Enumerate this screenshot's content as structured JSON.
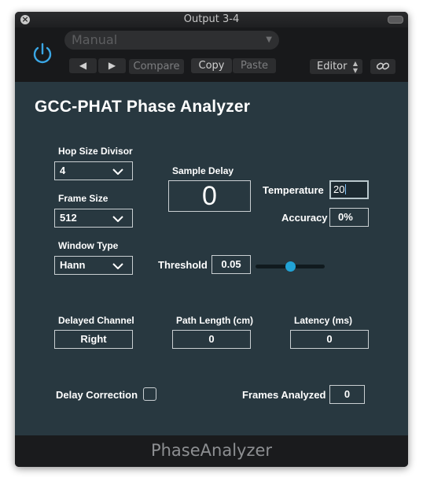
{
  "window": {
    "title": "Output 3-4"
  },
  "header": {
    "preset_value": "Manual",
    "prev_label": "◀",
    "next_label": "▶",
    "compare_label": "Compare",
    "copy_label": "Copy",
    "paste_label": "Paste",
    "editor_label": "Editor"
  },
  "plugin": {
    "title": "GCC-PHAT Phase Analyzer",
    "hop_size": {
      "label": "Hop Size Divisor",
      "value": "4"
    },
    "frame_size": {
      "label": "Frame Size",
      "value": "512"
    },
    "window_type": {
      "label": "Window Type",
      "value": "Hann"
    },
    "sample_delay": {
      "label": "Sample Delay",
      "value": "0"
    },
    "temperature": {
      "label": "Temperature",
      "value": "20"
    },
    "accuracy": {
      "label": "Accuracy",
      "value": "0%"
    },
    "threshold": {
      "label": "Threshold",
      "value": "0.05",
      "slider_fraction": 0.5
    },
    "delayed_channel": {
      "label": "Delayed Channel",
      "value": "Right"
    },
    "path_length": {
      "label": "Path Length (cm)",
      "value": "0"
    },
    "latency": {
      "label": "Latency (ms)",
      "value": "0"
    },
    "delay_correction": {
      "label": "Delay Correction",
      "checked": false
    },
    "frames_analyzed": {
      "label": "Frames Analyzed",
      "value": "0"
    }
  },
  "footer": {
    "name": "PhaseAnalyzer"
  },
  "colors": {
    "panel": "#283840",
    "accent": "#21a3d6",
    "chrome": "#1a1b1d"
  }
}
